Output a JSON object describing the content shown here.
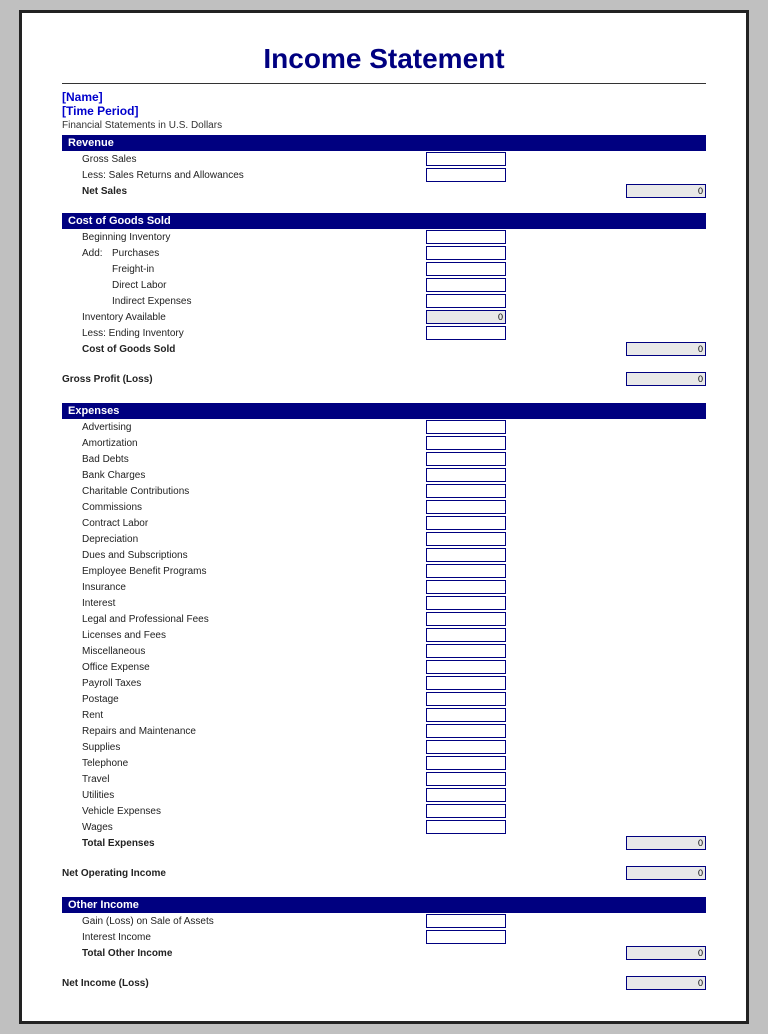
{
  "title": "Income Statement",
  "name_label": "[Name]",
  "period_label": "[Time Period]",
  "subtitle": "Financial Statements in U.S. Dollars",
  "sections": {
    "revenue": {
      "header": "Revenue",
      "rows": [
        {
          "label": "Gross Sales",
          "indent": 1,
          "has_input_mid": true,
          "has_input_right": false,
          "bold": false
        },
        {
          "label": "Less: Sales Returns and Allowances",
          "indent": 1,
          "has_input_mid": true,
          "has_input_right": false,
          "bold": false
        },
        {
          "label": "Net Sales",
          "indent": 1,
          "has_input_mid": false,
          "has_input_right": true,
          "bold": true,
          "value": "0"
        }
      ]
    },
    "cogs": {
      "header": "Cost of Goods Sold",
      "rows": [
        {
          "label": "Beginning Inventory",
          "indent": 1,
          "has_input_mid": true,
          "bold": false
        },
        {
          "label": "Purchases",
          "indent": 2,
          "has_input_mid": true,
          "bold": false
        },
        {
          "label": "Freight-in",
          "indent": 2,
          "has_input_mid": true,
          "bold": false
        },
        {
          "label": "Direct Labor",
          "indent": 2,
          "has_input_mid": true,
          "bold": false
        },
        {
          "label": "Indirect Expenses",
          "indent": 2,
          "has_input_mid": true,
          "bold": false
        },
        {
          "label": "Inventory Available",
          "indent": 1,
          "has_input_mid": true,
          "bold": false,
          "value": "0"
        },
        {
          "label": "Less: Ending Inventory",
          "indent": 1,
          "has_input_mid": true,
          "bold": false
        },
        {
          "label": "Cost of Goods Sold",
          "indent": 1,
          "bold": true,
          "has_input_right": true,
          "value": "0"
        }
      ]
    },
    "gross_profit": {
      "label": "Gross Profit (Loss)",
      "value": "0"
    },
    "expenses": {
      "header": "Expenses",
      "rows": [
        "Advertising",
        "Amortization",
        "Bad Debts",
        "Bank Charges",
        "Charitable Contributions",
        "Commissions",
        "Contract Labor",
        "Depreciation",
        "Dues and Subscriptions",
        "Employee Benefit Programs",
        "Insurance",
        "Interest",
        "Legal and Professional Fees",
        "Licenses and Fees",
        "Miscellaneous",
        "Office Expense",
        "Payroll Taxes",
        "Postage",
        "Rent",
        "Repairs and Maintenance",
        "Supplies",
        "Telephone",
        "Travel",
        "Utilities",
        "Vehicle Expenses",
        "Wages"
      ],
      "total_label": "Total Expenses",
      "total_value": "0"
    },
    "net_operating": {
      "label": "Net Operating Income",
      "value": "0"
    },
    "other_income": {
      "header": "Other Income",
      "rows": [
        {
          "label": "Gain (Loss) on Sale of Assets",
          "has_input_mid": true
        },
        {
          "label": "Interest Income",
          "has_input_mid": true
        }
      ],
      "total_label": "Total Other Income",
      "total_value": "0"
    },
    "net_income": {
      "label": "Net Income (Loss)",
      "value": "0"
    }
  }
}
